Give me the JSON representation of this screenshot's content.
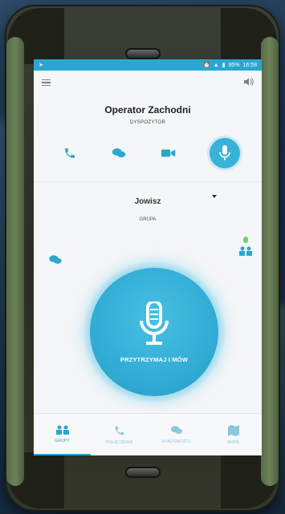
{
  "status_bar": {
    "time": "16:58",
    "battery": "95%"
  },
  "contact": {
    "name": "Operator Zachodni",
    "role": "DYSPOZYTOR"
  },
  "actions": [
    {
      "icon": "phone-icon"
    },
    {
      "icon": "chat-icon"
    },
    {
      "icon": "video-icon"
    },
    {
      "icon": "microphone-icon"
    }
  ],
  "group": {
    "selected": "Jowisz",
    "label": "GRUPA"
  },
  "ptt": {
    "label": "PRZYTRZYMAJ I MÓW"
  },
  "tabs": [
    {
      "label": "GRUPY",
      "icon": "group-icon",
      "active": true
    },
    {
      "label": "POŁĄCZENIA",
      "icon": "phone-icon",
      "active": false
    },
    {
      "label": "WIADOMOŚCI",
      "icon": "chat-icon",
      "active": false
    },
    {
      "label": "MAPA",
      "icon": "map-icon",
      "active": false
    }
  ],
  "colors": {
    "accent": "#2aa7d0",
    "button": "#39b2d8"
  }
}
